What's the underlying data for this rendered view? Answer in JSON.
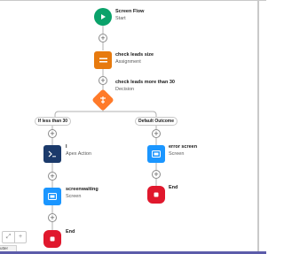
{
  "flow": {
    "start": {
      "title": "Screen Flow",
      "subtitle": "Start",
      "icon": "play-icon"
    },
    "assignment": {
      "title": "check leads size",
      "subtitle": "Assignment",
      "icon": "equals-icon"
    },
    "decision": {
      "title": "check leads more than 30",
      "subtitle": "Decision",
      "icon": "decision-icon"
    },
    "branches": [
      {
        "label": "If less than 30"
      },
      {
        "label": "Default Outcome"
      }
    ],
    "apex": {
      "title": "l",
      "subtitle": "Apex Action",
      "icon": "terminal-icon"
    },
    "screen_left": {
      "title": "screenwaiting",
      "subtitle": "Screen",
      "icon": "screen-icon"
    },
    "end_left": {
      "title": "End",
      "icon": "stop-icon"
    },
    "screen_right": {
      "title": "error screen",
      "subtitle": "Screen",
      "icon": "screen-icon"
    },
    "end_right": {
      "title": "End",
      "icon": "stop-icon"
    },
    "add_element_glyph": "+"
  },
  "toolbar": {
    "fit_glyph": "⤢",
    "zoom_in_glyph": "+"
  },
  "bottom_tab": {
    "label": "utter"
  },
  "colors": {
    "start": "#0aa26a",
    "assignment": "#e77a0e",
    "decision": "#ff7a29",
    "apex": "#1b3a6b",
    "screen": "#1b96ff",
    "end": "#e0182d",
    "connector": "#b0b0b0",
    "accent_bar": "#5c5caa"
  }
}
